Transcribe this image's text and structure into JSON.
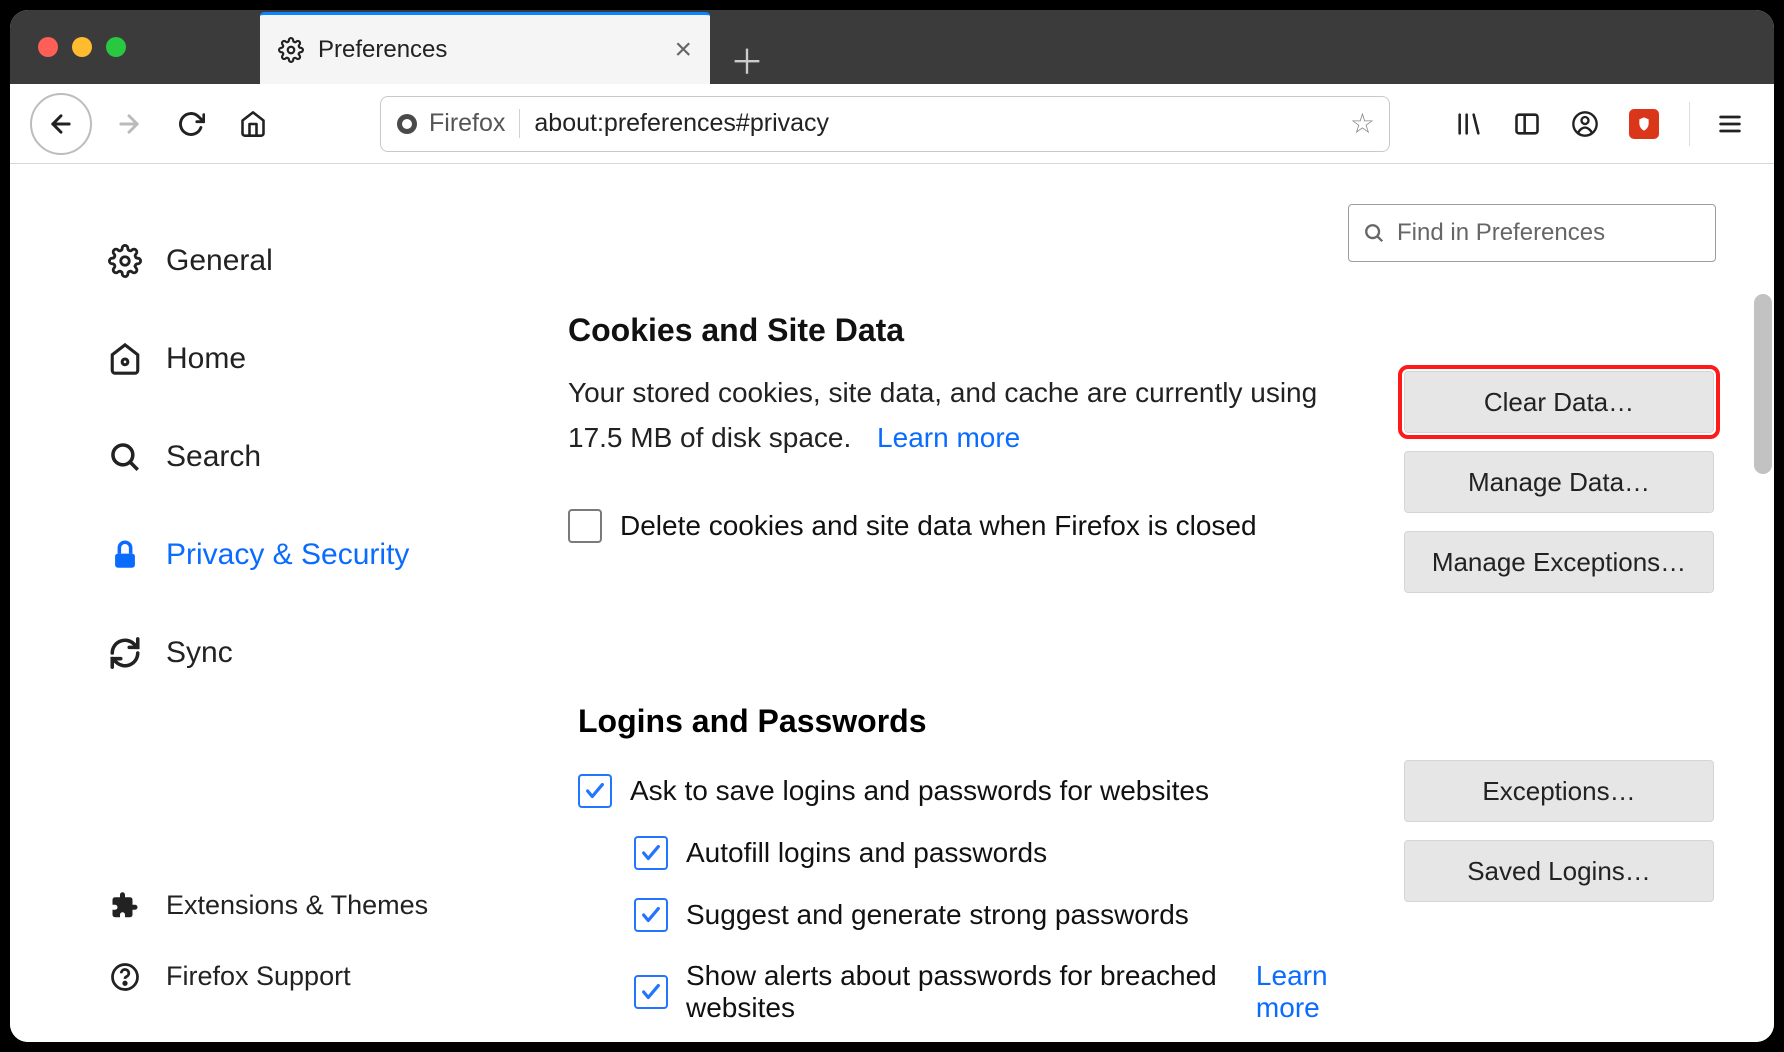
{
  "tab": {
    "title": "Preferences"
  },
  "url": {
    "identity": "Firefox",
    "address": "about:preferences#privacy"
  },
  "search": {
    "placeholder": "Find in Preferences"
  },
  "sidebar": {
    "items": [
      {
        "label": "General"
      },
      {
        "label": "Home"
      },
      {
        "label": "Search"
      },
      {
        "label": "Privacy & Security"
      },
      {
        "label": "Sync"
      }
    ],
    "bottom": [
      {
        "label": "Extensions & Themes"
      },
      {
        "label": "Firefox Support"
      }
    ]
  },
  "cookies": {
    "heading": "Cookies and Site Data",
    "desc1": "Your stored cookies, site data, and cache are currently using 17.5 MB of disk space.",
    "learn_more": "Learn more",
    "delete_on_close": "Delete cookies and site data when Firefox is closed",
    "buttons": {
      "clear": "Clear Data…",
      "manage": "Manage Data…",
      "exceptions": "Manage Exceptions…"
    }
  },
  "logins": {
    "heading": "Logins and Passwords",
    "ask_save": "Ask to save logins and passwords for websites",
    "autofill": "Autofill logins and passwords",
    "suggest": "Suggest and generate strong passwords",
    "alerts": "Show alerts about passwords for breached websites",
    "learn_more": "Learn more",
    "buttons": {
      "exceptions": "Exceptions…",
      "saved": "Saved Logins…"
    }
  }
}
